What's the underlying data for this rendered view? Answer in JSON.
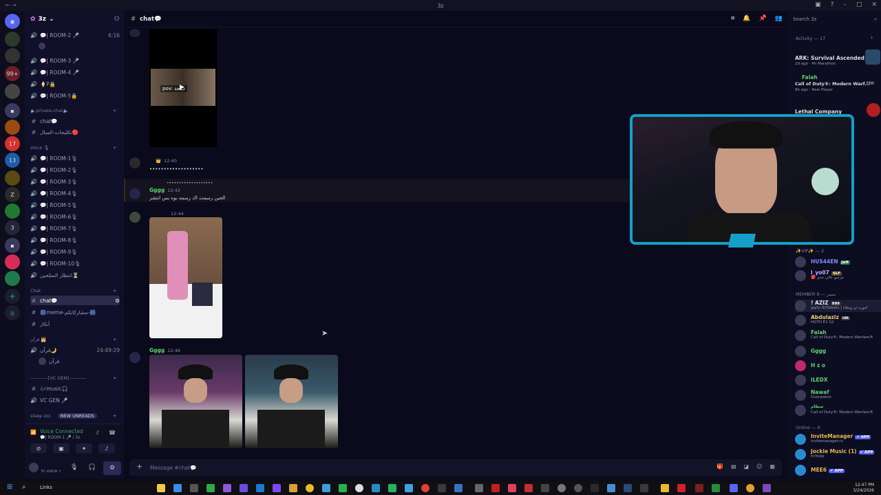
{
  "window": {
    "title": "3z"
  },
  "servers": [
    {
      "label": "3"
    },
    {
      "label": "99+"
    },
    {
      "label": "17"
    },
    {
      "label": "13"
    },
    {
      "label": "3"
    }
  ],
  "sidebar": {
    "server_name": "3z",
    "channels": [
      {
        "label": "💬| ROOM-2 🎤",
        "time": "6:16"
      },
      {
        "label": "💬| ROOM-3 🎤"
      },
      {
        "label": "💬| ROOM-4 🎤"
      },
      {
        "label": "🍦P🔒"
      },
      {
        "label": "💬| ROOM-5🔒"
      }
    ],
    "cat_private": "🔈private-chat🔈",
    "private_chat": "chat💬",
    "private_2": "تكليجات-الميال🔴",
    "cat_voice": "Voice 🎙",
    "voice_rooms": [
      "💬| ROOM-1🎙",
      "💬| ROOM-2🎙",
      "💬| ROOM-3🎙",
      "💬| ROOM-4🎙",
      "💬| ROOM-5🎙",
      "💬| ROOM-6🎙",
      "💬| ROOM-7🎙",
      "💬| ROOM-8🎙",
      "💬| ROOM-9🎙",
      "💬| ROOM-10🎙"
    ],
    "waiting": "انتظار المتلحين⏳",
    "cat_chat": "Chat",
    "chat_active": "chat💬",
    "meme": "🎆meme-مشاركاتكم-🎆",
    "ankar": "أنكار",
    "cat_quran": "قرآن 🕌",
    "quran": "قرآن🌙",
    "quran_time": "24:49:29",
    "quran_user": "قرآن",
    "cat_vcgen": "-----------[VC GEN]-----------",
    "music": "🎶music🎧",
    "vcgen": "VC GEN 🎤",
    "sleep": "sleep zzz",
    "new_unreads": "NEW UNREADS"
  },
  "voice_panel": {
    "title": "Voice Connected",
    "sub": "💬| ROOM-1 🎤 / 3z",
    "status": "In voice •"
  },
  "main": {
    "channel": "chat💬",
    "video_title": "pov: ديلجة",
    "msg1_time": "12:40",
    "msg1_text": "•••••••••••••••••••",
    "reply_preview": "•••••••••••••••••••",
    "msg2_name": "Gggg",
    "msg2_time": "12:42",
    "msg2_text": "الحين رسمت اك رسمه بوه بس انتشر",
    "msg3_time": "12:44",
    "msg4_name": "Gggg",
    "msg4_time": "12:46",
    "composer_placeholder": "Message #chat💬"
  },
  "members": {
    "search_placeholder": "Search 3z",
    "activity_title": "Activity — 17",
    "activities": [
      {
        "name": "ARK: Survival Ascended",
        "sub": "2d ago · 4h Marathon"
      },
      {
        "name": "Falah",
        "game": "Call of Duty®: Modern Warf...",
        "sub": "8h ago · New Player"
      },
      {
        "name": "Lethal Company",
        "sub": ""
      }
    ],
    "vip_title": "✨VIP✨ — 2",
    "vip": [
      {
        "name": "HUS44EN",
        "tag": "Jeff",
        "color": "#7f8cff"
      },
      {
        "name": "l_yo07",
        "tag": "SLF",
        "sub": "🔴 مرحبو عالي جدي",
        "color": "#b9b0ff"
      }
    ],
    "member_title": "MEMBER ممبر — 8",
    "members": [
      {
        "name": "! AZIZ",
        "tag": "999",
        "sub": "gg/ly-3j7jbeatu | اموره تي وبطاء",
        "color": "#e0e0ee"
      },
      {
        "name": "Abdulaziz",
        "tag": "idk",
        "sub": "HOTD E1 S2",
        "color": "#e8d07a"
      },
      {
        "name": "Falah",
        "sub": "Call of Duty®: Modern Warfare®",
        "color": "#5fd36f"
      },
      {
        "name": "Gggg",
        "color": "#5fd36f"
      },
      {
        "name": "H z o",
        "color": "#5fd36f"
      },
      {
        "name": "iLEDX",
        "color": "#5fd36f"
      },
      {
        "name": "Nawaf",
        "sub": "Overwatch",
        "color": "#5fd36f"
      },
      {
        "name": "سطام",
        "sub": "Call of Duty®: Modern Warfare®",
        "color": "#5fd36f"
      }
    ],
    "online_title": "Online — 6",
    "online": [
      {
        "name": "InviteManager",
        "tag": "✔ APP",
        "sub": "invitemanager.cc",
        "color": "#e8b84f"
      },
      {
        "name": "Jockie Music (1)",
        "tag": "✔ APP",
        "sub": "m!help",
        "color": "#e8b84f"
      },
      {
        "name": "MEE6",
        "tag": "✔ APP",
        "color": "#e8b84f"
      }
    ]
  },
  "taskbar": {
    "search": "Links",
    "time": "12:47 PM",
    "date": "3/24/2026"
  }
}
